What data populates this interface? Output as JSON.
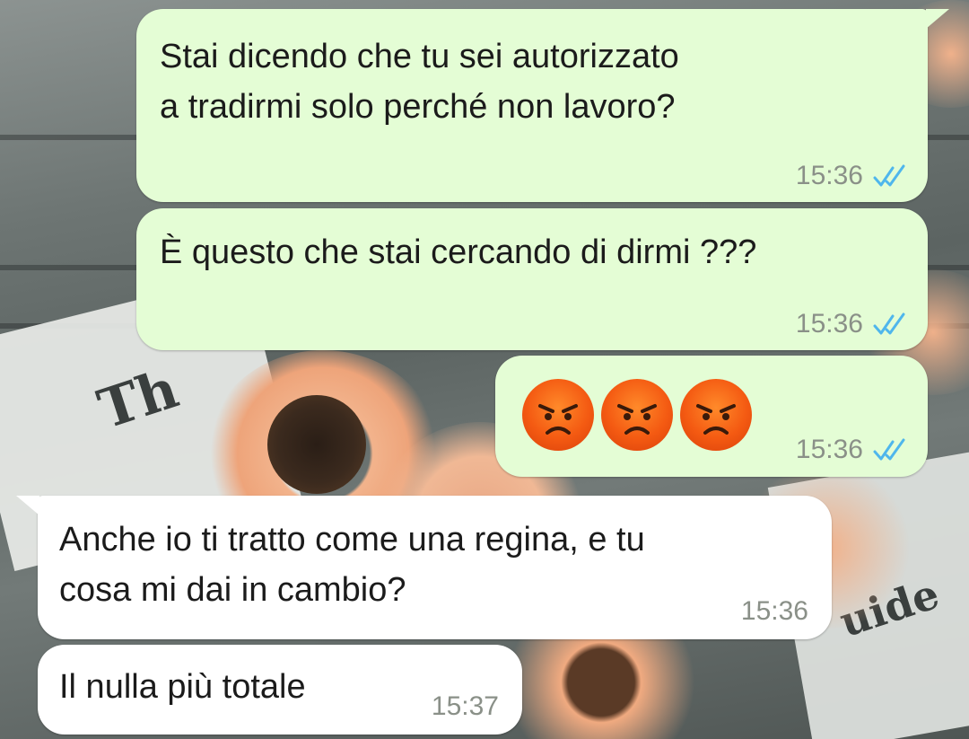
{
  "messages": [
    {
      "direction": "outgoing",
      "lines": [
        "Stai dicendo che tu sei autorizzato",
        "a tradirmi solo perché non lavoro?"
      ],
      "time": "15:36",
      "status": "read"
    },
    {
      "direction": "outgoing",
      "lines": [
        "È questo che stai cercando di dirmi ???"
      ],
      "time": "15:36",
      "status": "read"
    },
    {
      "direction": "outgoing",
      "emojis": [
        "angry-face",
        "angry-face",
        "angry-face"
      ],
      "time": "15:36",
      "status": "read"
    },
    {
      "direction": "incoming",
      "lines": [
        "Anche io ti tratto come una regina, e tu",
        "cosa mi dai in cambio?"
      ],
      "time": "15:36"
    },
    {
      "direction": "incoming",
      "lines": [
        "Il nulla più totale"
      ],
      "time": "15:37"
    }
  ],
  "colors": {
    "outgoing_bubble": "#e4fdd5",
    "incoming_bubble": "#ffffff",
    "read_ticks": "#4fb6ec",
    "timestamp": "#8a9088"
  }
}
